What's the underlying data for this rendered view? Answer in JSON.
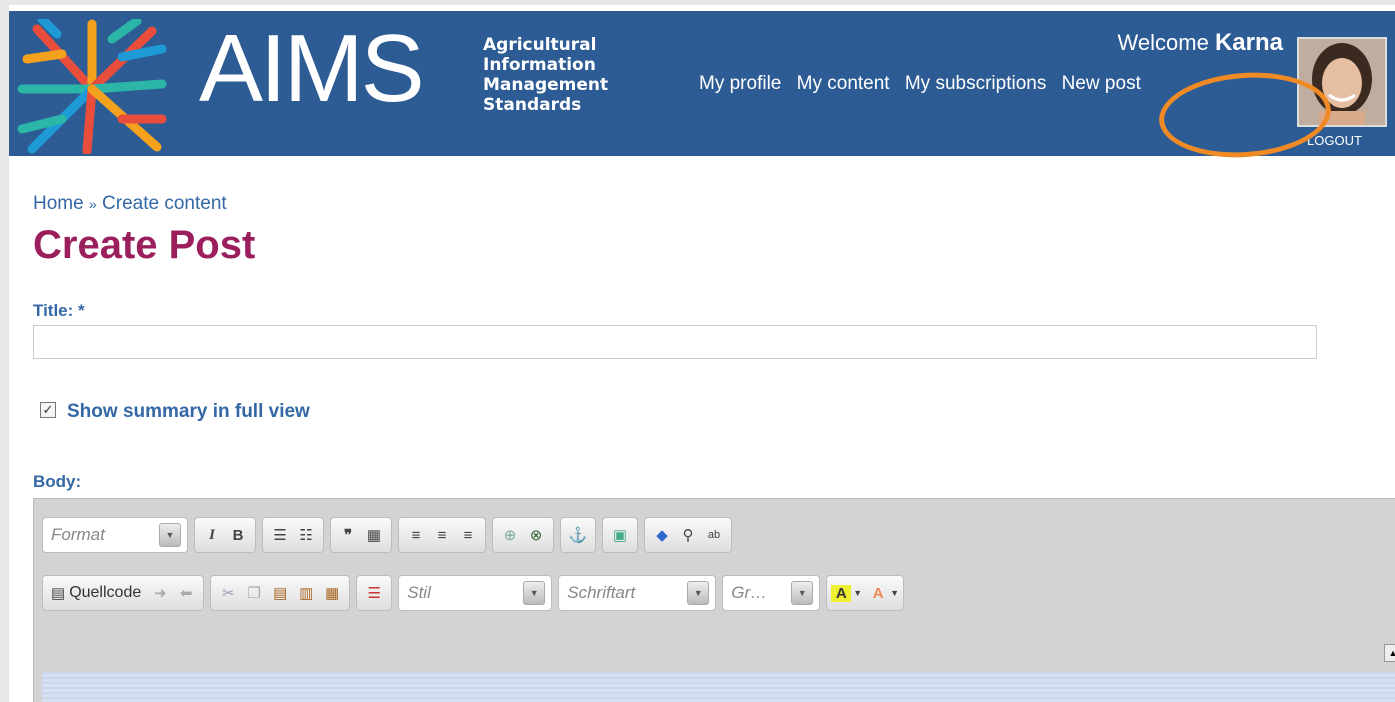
{
  "header": {
    "logo_text": "AIMS",
    "logo_subtitle": [
      "Agricultural",
      "Information",
      "Management",
      "Standards"
    ],
    "welcome_prefix": "Welcome",
    "user_name": "Karna",
    "nav": [
      "My profile",
      "My content",
      "My subscriptions",
      "New post"
    ],
    "logout": "LOGOUT"
  },
  "breadcrumb": {
    "home": "Home",
    "separator": "»",
    "current": "Create content"
  },
  "page_title": "Create Post",
  "form": {
    "title_label": "Title: *",
    "title_value": "",
    "summary_checkbox_label": "Show summary in full view",
    "summary_checked": true,
    "body_label": "Body:"
  },
  "editor": {
    "format_placeholder": "Format",
    "source_label": "Quellcode",
    "style_placeholder": "Stil",
    "font_placeholder": "Schriftart",
    "size_placeholder": "Gr…"
  },
  "colors": {
    "header_bg": "#2d5b94",
    "title": "#9b1f5c",
    "link": "#3468a6",
    "highlight": "#f08a24"
  }
}
